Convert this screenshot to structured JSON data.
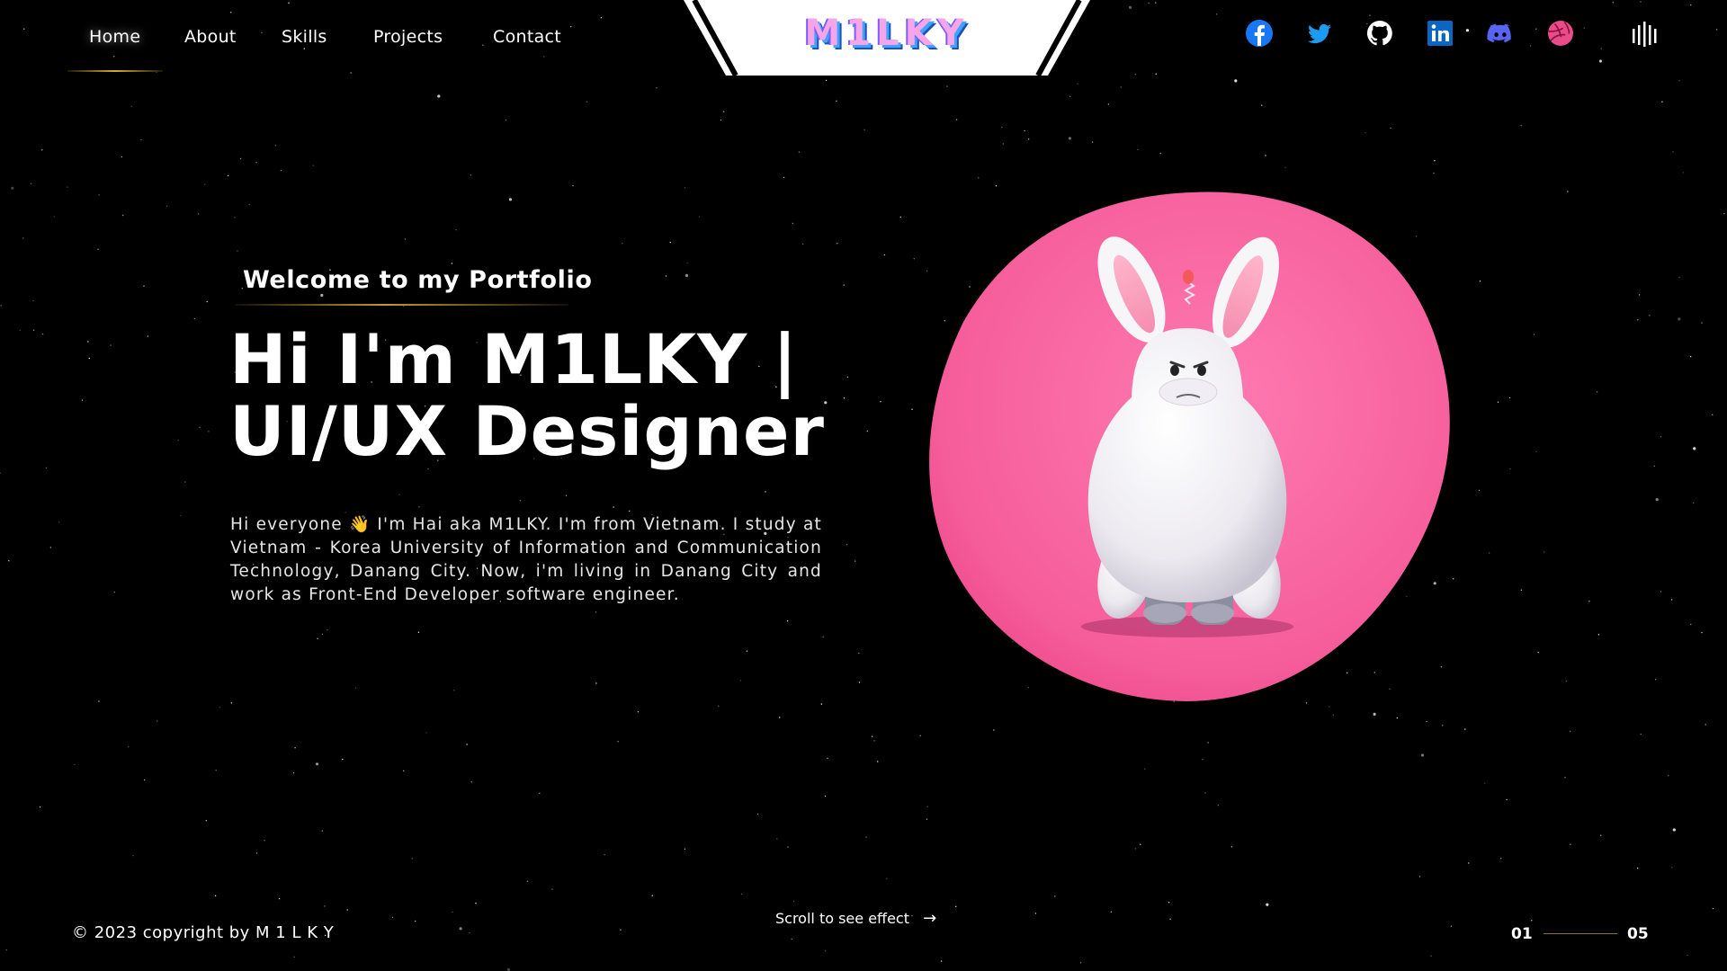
{
  "nav": {
    "items": [
      {
        "label": "Home",
        "active": true
      },
      {
        "label": "About"
      },
      {
        "label": "Skills"
      },
      {
        "label": "Projects"
      },
      {
        "label": "Contact"
      }
    ]
  },
  "logo": {
    "text": "M1LKY"
  },
  "social": [
    {
      "icon": "facebook-icon",
      "color": "#1877f2"
    },
    {
      "icon": "twitter-icon",
      "color": "#1d9bf0"
    },
    {
      "icon": "github-icon",
      "color": "#ffffff"
    },
    {
      "icon": "linkedin-icon",
      "color": "#0a66c2"
    },
    {
      "icon": "discord-icon",
      "color": "#5865f2"
    },
    {
      "icon": "dribbble-icon",
      "color": "#ea4c89"
    }
  ],
  "hero": {
    "welcome": "Welcome to my Portfolio",
    "headline_line1": "Hi I'm M1LKY |",
    "headline_line2": "UI/UX Designer",
    "bio": "Hi everyone 👋 I'm Hai aka M1LKY. I'm from Vietnam. I study at Vietnam - Korea University of Information and Communication Technology, Danang City. Now, i'm living in Danang City and work as Front-End Developer software engineer."
  },
  "footer": {
    "copyright": "© 2023 copyright by M 1 L K Y",
    "scroll_hint": "Scroll to see effect",
    "page_current": "01",
    "page_total": "05"
  },
  "colors": {
    "accent_gold": "#d8ac2e",
    "blob_pink": "#f25592",
    "logo_pink": "#f6a6e8"
  }
}
